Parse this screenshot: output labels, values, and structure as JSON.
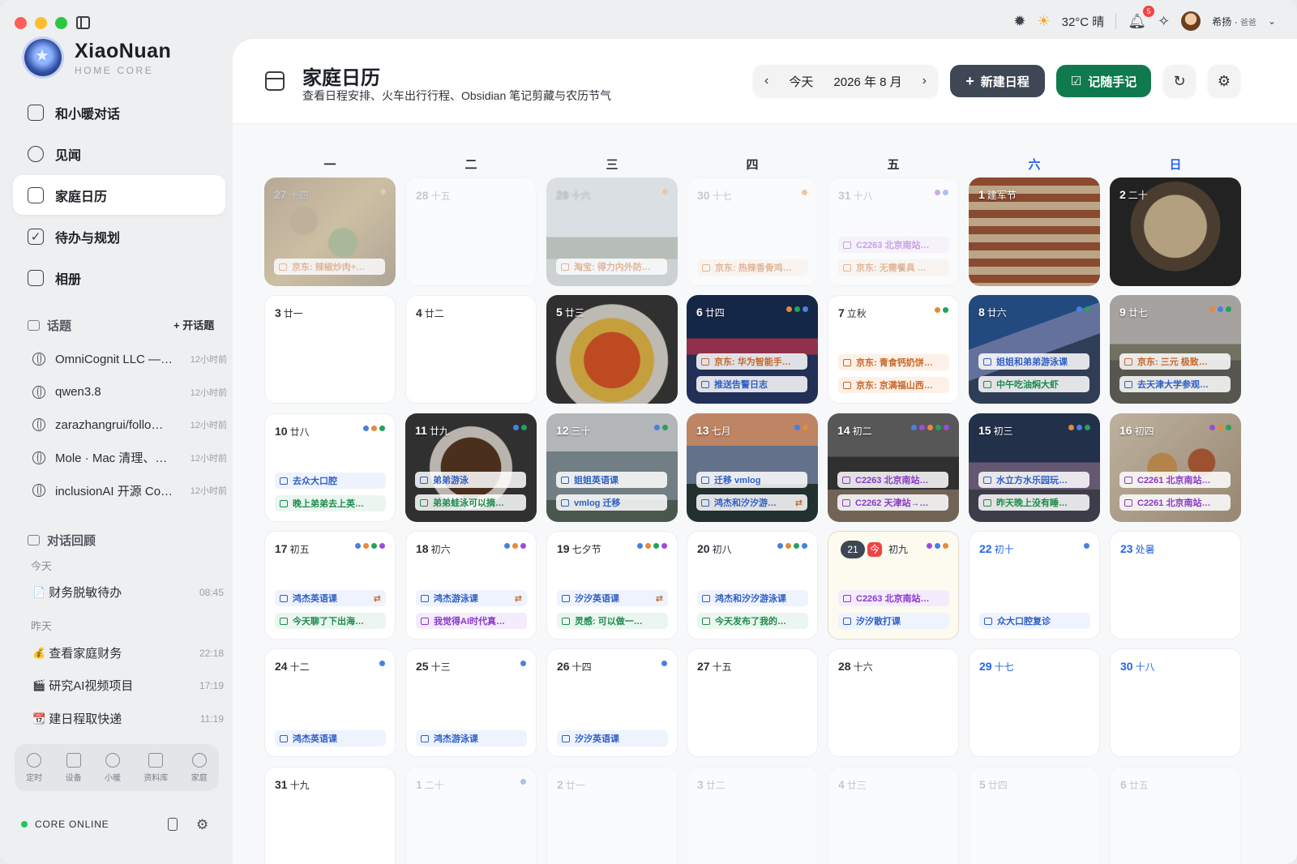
{
  "window": {
    "traffic_lights": [
      "close",
      "minimize",
      "zoom"
    ]
  },
  "topbar": {
    "weather": "32°C 晴",
    "notifications": "5",
    "user_name": "希扬",
    "user_role": "爸爸"
  },
  "brand": {
    "name": "XiaoNuan",
    "subtitle": "HOME CORE"
  },
  "nav": [
    {
      "label": "和小暖对话",
      "icon": "chat-icon"
    },
    {
      "label": "见闻",
      "icon": "compass-icon"
    },
    {
      "label": "家庭日历",
      "icon": "calendar-icon",
      "active": true
    },
    {
      "label": "待办与规划",
      "icon": "checkbox-icon"
    },
    {
      "label": "相册",
      "icon": "camera-icon"
    }
  ],
  "topics_section": {
    "title": "话题",
    "add_label": "+ 开话题"
  },
  "topics": [
    {
      "title": "OmniCognit LLC —…",
      "time": "12小时前"
    },
    {
      "title": "qwen3.8",
      "time": "12小时前"
    },
    {
      "title": "zarazhangrui/follo…",
      "time": "12小时前"
    },
    {
      "title": "Mole · Mac 清理、…",
      "time": "12小时前"
    },
    {
      "title": "inclusionAI 开源 Co…",
      "time": "12小时前"
    }
  ],
  "review_section": {
    "title": "对话回顾",
    "today": "今天",
    "yesterday": "昨天"
  },
  "conversations": [
    {
      "icon": "📄",
      "title": "财务脱敏待办",
      "time": "08:45"
    },
    {
      "icon": "💰",
      "title": "查看家庭财务",
      "time": "22:18"
    },
    {
      "icon": "🎬",
      "title": "研究AI视频项目",
      "time": "17:19"
    },
    {
      "icon": "📆",
      "title": "建日程取快递",
      "time": "11:19"
    }
  ],
  "dock": [
    "定时",
    "设备",
    "小暖",
    "资料库",
    "家庭"
  ],
  "status": {
    "text": "CORE ONLINE"
  },
  "header": {
    "title": "家庭日历",
    "subtitle": "查看日程安排、火车出行行程、Obsidian 笔记剪藏与农历节气",
    "today_btn": "今天",
    "month": "2026 年 8 月",
    "new_event_btn": "新建日程",
    "note_btn": "记随手记"
  },
  "weekdays": [
    "一",
    "二",
    "三",
    "四",
    "五",
    "六",
    "日"
  ],
  "colors": {
    "blue": "#4a7fe0",
    "orange": "#e58a3c",
    "green": "#22a35a",
    "purple": "#9b4dd6",
    "accent_green": "#0f7a4d"
  },
  "weeks": [
    [
      {
        "d": "27",
        "l": "十四",
        "dim": true,
        "photo": "stirfry",
        "dots": [
          "orange"
        ],
        "ev": [
          {
            "t": "京东: 辣椒炒肉+…",
            "c": "orange"
          }
        ]
      },
      {
        "d": "28",
        "l": "十五",
        "dim": true,
        "ev": []
      },
      {
        "d": "29",
        "l": "十六",
        "dim": true,
        "photo": "city",
        "dots": [
          "orange"
        ],
        "ev": [
          {
            "t": "淘宝: 得力内外防…",
            "c": "orange"
          }
        ]
      },
      {
        "d": "30",
        "l": "十七",
        "dim": true,
        "dots": [
          "orange"
        ],
        "ev": [
          {
            "t": "京东: 热辣香骨鸡…",
            "c": "orange"
          }
        ]
      },
      {
        "d": "31",
        "l": "十八",
        "dim": true,
        "dots": [
          "purple",
          "blue"
        ],
        "ev": [
          {
            "t": "C2263 北京南站…",
            "c": "purple"
          },
          {
            "t": "京东: 无需餐具 …",
            "c": "orange"
          }
        ]
      },
      {
        "d": "1",
        "l": "建军节",
        "photo": "church",
        "ev": []
      },
      {
        "d": "2",
        "l": "二十",
        "photo": "noodles",
        "ev": []
      }
    ],
    [
      {
        "d": "3",
        "l": "廿一",
        "ev": []
      },
      {
        "d": "4",
        "l": "廿二",
        "ev": []
      },
      {
        "d": "5",
        "l": "廿三",
        "photo": "tomatoegg",
        "ev": []
      },
      {
        "d": "6",
        "l": "廿四",
        "photo": "stage",
        "dots": [
          "orange",
          "green",
          "blue"
        ],
        "ev": [
          {
            "t": "京东: 华为智能手…",
            "c": "orange"
          },
          {
            "t": "推送告警日志",
            "c": "blue"
          }
        ]
      },
      {
        "d": "7",
        "l": "立秋",
        "dots": [
          "orange",
          "green"
        ],
        "ev": [
          {
            "t": "京东: 青食钙奶饼…",
            "c": "orange"
          },
          {
            "t": "京东: 京满福山西…",
            "c": "orange"
          }
        ]
      },
      {
        "d": "8",
        "l": "廿六",
        "photo": "tv",
        "dots": [
          "blue",
          "green"
        ],
        "ev": [
          {
            "t": "姐姐和弟弟游泳课",
            "c": "blue"
          },
          {
            "t": "中午吃油焖大虾",
            "c": "green"
          }
        ]
      },
      {
        "d": "9",
        "l": "廿七",
        "photo": "street",
        "dots": [
          "orange",
          "blue",
          "green"
        ],
        "ev": [
          {
            "t": "京东: 三元 极致…",
            "c": "orange"
          },
          {
            "t": "去天津大学参观…",
            "c": "blue"
          }
        ]
      }
    ],
    [
      {
        "d": "10",
        "l": "廿八",
        "dots": [
          "blue",
          "orange",
          "green"
        ],
        "ev": [
          {
            "t": "去众大口腔",
            "c": "blue"
          },
          {
            "t": "晚上弟弟去上英…",
            "c": "green"
          }
        ]
      },
      {
        "d": "11",
        "l": "廿九",
        "photo": "meat",
        "dots": [
          "blue",
          "green"
        ],
        "ev": [
          {
            "t": "弟弟游泳",
            "c": "blue"
          },
          {
            "t": "弟弟蛙泳可以摘…",
            "c": "green"
          }
        ]
      },
      {
        "d": "12",
        "l": "三十",
        "photo": "buildings",
        "dots": [
          "blue",
          "green"
        ],
        "ev": [
          {
            "t": "姐姐英语课",
            "c": "blue"
          },
          {
            "t": "vmlog 迁移",
            "c": "blue"
          }
        ]
      },
      {
        "d": "13",
        "l": "七月",
        "photo": "sunset",
        "dots": [
          "blue",
          "orange"
        ],
        "ev": [
          {
            "t": "迁移 vmlog",
            "c": "blue"
          },
          {
            "t": "鸿杰和汐汐游…",
            "c": "blue",
            "rep": true
          }
        ]
      },
      {
        "d": "14",
        "l": "初二",
        "photo": "scooter",
        "dots": [
          "blue",
          "purple",
          "orange",
          "green",
          "purple"
        ],
        "ev": [
          {
            "t": "C2263 北京南站…",
            "c": "purple"
          },
          {
            "t": "C2262 天津站→…",
            "c": "purple"
          }
        ]
      },
      {
        "d": "15",
        "l": "初三",
        "photo": "plaza",
        "dots": [
          "orange",
          "blue",
          "green"
        ],
        "ev": [
          {
            "t": "水立方水乐园玩…",
            "c": "blue"
          },
          {
            "t": "昨天晚上没有睡…",
            "c": "green"
          }
        ]
      },
      {
        "d": "16",
        "l": "初四",
        "photo": "buffet",
        "dots": [
          "purple",
          "orange",
          "green"
        ],
        "ev": [
          {
            "t": "C2261 北京南站…",
            "c": "purple"
          },
          {
            "t": "C2261 北京南站…",
            "c": "purple"
          }
        ]
      }
    ],
    [
      {
        "d": "17",
        "l": "初五",
        "dots": [
          "blue",
          "orange",
          "green",
          "purple"
        ],
        "ev": [
          {
            "t": "鸿杰英语课",
            "c": "blue",
            "rep": true
          },
          {
            "t": "今天聊了下出海…",
            "c": "green"
          }
        ]
      },
      {
        "d": "18",
        "l": "初六",
        "dots": [
          "blue",
          "orange",
          "purple"
        ],
        "ev": [
          {
            "t": "鸿杰游泳课",
            "c": "blue",
            "rep": true
          },
          {
            "t": "我觉得AI时代真…",
            "c": "purple"
          }
        ]
      },
      {
        "d": "19",
        "l": "七夕节",
        "dots": [
          "blue",
          "orange",
          "green",
          "purple"
        ],
        "ev": [
          {
            "t": "汐汐英语课",
            "c": "blue",
            "rep": true
          },
          {
            "t": "灵感: 可以做一…",
            "c": "green"
          }
        ]
      },
      {
        "d": "20",
        "l": "初八",
        "dots": [
          "blue",
          "orange",
          "green",
          "blue"
        ],
        "ev": [
          {
            "t": "鸿杰和汐汐游泳课",
            "c": "blue"
          },
          {
            "t": "今天发布了我的…",
            "c": "green"
          }
        ]
      },
      {
        "d": "21",
        "l": "初九",
        "today": true,
        "today_tag": "今",
        "dots": [
          "purple",
          "blue",
          "orange"
        ],
        "ev": [
          {
            "t": "C2263 北京南站…",
            "c": "purple"
          },
          {
            "t": "汐汐散打课",
            "c": "blue"
          }
        ]
      },
      {
        "d": "22",
        "l": "初十",
        "weekend": true,
        "dots": [
          "blue"
        ],
        "ev": [
          {
            "t": "众大口腔复诊",
            "c": "blue",
            "slot": 1
          }
        ]
      },
      {
        "d": "23",
        "l": "处暑",
        "weekend": true,
        "ev": []
      }
    ],
    [
      {
        "d": "24",
        "l": "十二",
        "dots": [
          "blue"
        ],
        "ev": [
          {
            "t": "鸿杰英语课",
            "c": "blue",
            "slot": 1
          }
        ]
      },
      {
        "d": "25",
        "l": "十三",
        "dots": [
          "blue"
        ],
        "ev": [
          {
            "t": "鸿杰游泳课",
            "c": "blue",
            "slot": 1
          }
        ]
      },
      {
        "d": "26",
        "l": "十四",
        "dots": [
          "blue"
        ],
        "ev": [
          {
            "t": "汐汐英语课",
            "c": "blue",
            "slot": 1
          }
        ]
      },
      {
        "d": "27",
        "l": "十五",
        "ev": []
      },
      {
        "d": "28",
        "l": "十六",
        "ev": []
      },
      {
        "d": "29",
        "l": "十七",
        "weekend": true,
        "ev": []
      },
      {
        "d": "30",
        "l": "十八",
        "weekend": true,
        "ev": []
      }
    ],
    [
      {
        "d": "31",
        "l": "十九",
        "ev": []
      },
      {
        "d": "1",
        "l": "二十",
        "dim": true,
        "dots": [
          "blue"
        ],
        "ev": []
      },
      {
        "d": "2",
        "l": "廿一",
        "dim": true,
        "ev": []
      },
      {
        "d": "3",
        "l": "廿二",
        "dim": true,
        "ev": []
      },
      {
        "d": "4",
        "l": "廿三",
        "dim": true,
        "ev": []
      },
      {
        "d": "5",
        "l": "廿四",
        "dim": true,
        "weekend": true,
        "ev": []
      },
      {
        "d": "6",
        "l": "廿五",
        "dim": true,
        "weekend": true,
        "ev": []
      }
    ]
  ]
}
